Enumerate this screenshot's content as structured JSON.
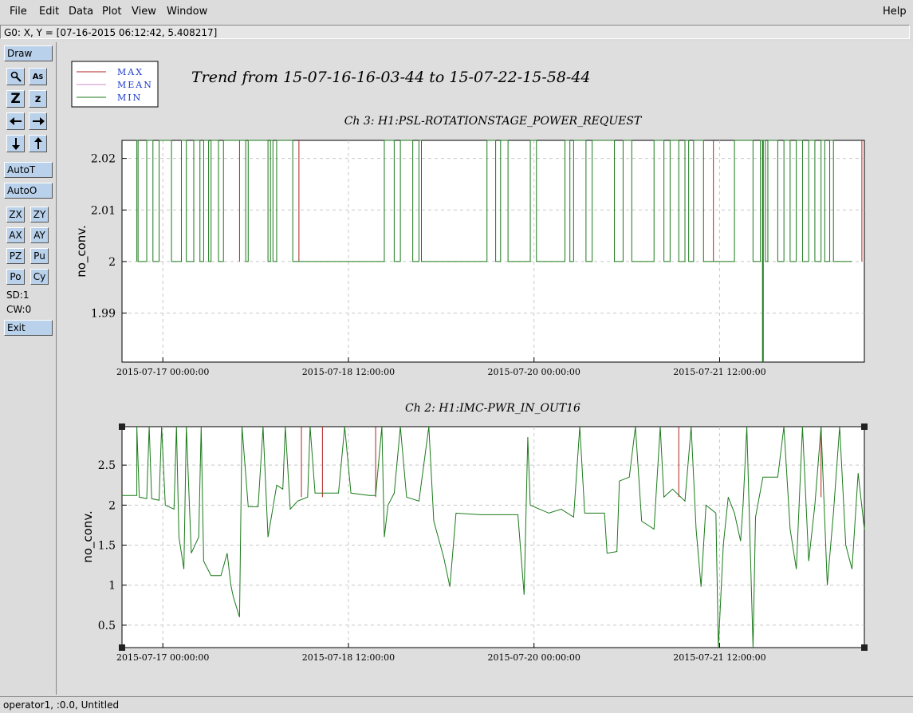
{
  "menu": {
    "file": "File",
    "edit": "Edit",
    "data": "Data",
    "plot": "Plot",
    "view": "View",
    "window": "Window",
    "help": "Help"
  },
  "coord_readout": "G0: X, Y = [07-16-2015 06:12:42, 5.408217]",
  "toolbox": {
    "draw": "Draw",
    "autot": "AutoT",
    "autoo": "AutoO",
    "zx": "ZX",
    "zy": "ZY",
    "ax": "AX",
    "ay": "AY",
    "pz": "PZ",
    "pu": "Pu",
    "po": "Po",
    "cy": "Cy",
    "sd": "SD:1",
    "cw": "CW:0",
    "exit": "Exit"
  },
  "legend": {
    "max": "MAX",
    "mean": "MEAN",
    "min": "MIN",
    "colors": {
      "max": "#b22222",
      "mean": "#cc88cc",
      "min": "#1a7a1a"
    }
  },
  "plot_title": "Trend from 15-07-16-16-03-44 to 15-07-22-15-58-44",
  "status": "operator1, :0.0, Untitled",
  "chart_data": [
    {
      "type": "line",
      "title": "Ch 3: H1:PSL-ROTATIONSTAGE_POWER_REQUEST",
      "ylabel": "no_conv.",
      "xlabel": "",
      "x_ticks": [
        "2015-07-17 00:00:00",
        "2015-07-18 12:00:00",
        "2015-07-20 00:00:00",
        "2015-07-21 12:00:00"
      ],
      "y_ticks": [
        "2.02",
        "2.01",
        "2",
        "1.99"
      ],
      "ylim": [
        1.9805,
        2.0235
      ],
      "x_days": [
        0,
        6
      ],
      "x_tick_days": [
        0.33,
        1.83,
        3.33,
        4.83
      ],
      "grid": true,
      "baseline": 2.0,
      "high": 2.0235,
      "series": [
        {
          "name": "MIN",
          "pulses_days": [
            [
              0.12,
              0.13
            ],
            [
              0.2,
              0.25
            ],
            [
              0.3,
              0.4
            ],
            [
              0.48,
              0.52
            ],
            [
              0.58,
              0.63
            ],
            [
              0.66,
              0.7
            ],
            [
              0.72,
              0.78
            ],
            [
              0.82,
              1.0
            ],
            [
              1.02,
              1.18
            ],
            [
              1.2,
              1.22
            ],
            [
              1.25,
              1.38
            ],
            [
              2.12,
              2.2
            ],
            [
              2.25,
              2.35
            ],
            [
              2.4,
              2.42
            ],
            [
              2.95,
              3.02
            ],
            [
              3.06,
              3.12
            ],
            [
              3.3,
              3.35
            ],
            [
              3.58,
              3.62
            ],
            [
              3.65,
              3.75
            ],
            [
              3.8,
              3.98
            ],
            [
              4.05,
              4.12
            ],
            [
              4.3,
              4.38
            ],
            [
              4.43,
              4.5
            ],
            [
              4.55,
              4.58
            ],
            [
              4.62,
              4.7
            ],
            [
              4.95,
              5.1
            ],
            [
              5.16,
              5.2
            ],
            [
              5.22,
              5.3
            ],
            [
              5.35,
              5.4
            ],
            [
              5.45,
              5.5
            ],
            [
              5.55,
              5.6
            ],
            [
              5.65,
              5.68
            ],
            [
              5.72,
              5.75
            ]
          ],
          "dip_day": 5.18,
          "dip": 1.9805
        },
        {
          "name": "MAX",
          "spikes_days": [
            0.95,
            1.43,
            4.78,
            5.98
          ]
        }
      ]
    },
    {
      "type": "line",
      "title": "Ch 2: H1:IMC-PWR_IN_OUT16",
      "ylabel": "no_conv.",
      "xlabel": "",
      "x_ticks": [
        "2015-07-17 00:00:00",
        "2015-07-18 12:00:00",
        "2015-07-20 00:00:00",
        "2015-07-21 12:00:00"
      ],
      "y_ticks": [
        "2.5",
        "2",
        "1.5",
        "1",
        "0.5"
      ],
      "ylim": [
        0.22,
        2.98
      ],
      "x_days": [
        0,
        6
      ],
      "x_tick_days": [
        0.33,
        1.83,
        3.33,
        4.83
      ],
      "grid": true,
      "series": [
        {
          "name": "MIN",
          "points_days": [
            [
              0,
              2.12
            ],
            [
              0.12,
              2.12
            ],
            [
              0.12,
              2.98
            ],
            [
              0.14,
              2.1
            ],
            [
              0.2,
              2.08
            ],
            [
              0.22,
              2.98
            ],
            [
              0.24,
              2.08
            ],
            [
              0.3,
              2.06
            ],
            [
              0.32,
              2.98
            ],
            [
              0.35,
              2.0
            ],
            [
              0.42,
              1.95
            ],
            [
              0.44,
              2.98
            ],
            [
              0.46,
              1.6
            ],
            [
              0.5,
              1.2
            ],
            [
              0.52,
              2.98
            ],
            [
              0.56,
              1.4
            ],
            [
              0.62,
              1.6
            ],
            [
              0.64,
              2.98
            ],
            [
              0.66,
              1.3
            ],
            [
              0.72,
              1.12
            ],
            [
              0.8,
              1.12
            ],
            [
              0.85,
              1.4
            ],
            [
              0.88,
              1.0
            ],
            [
              0.9,
              0.85
            ],
            [
              0.95,
              0.6
            ],
            [
              0.97,
              2.98
            ],
            [
              1.02,
              1.98
            ],
            [
              1.1,
              1.98
            ],
            [
              1.14,
              2.98
            ],
            [
              1.18,
              1.6
            ],
            [
              1.25,
              2.25
            ],
            [
              1.3,
              2.2
            ],
            [
              1.32,
              2.98
            ],
            [
              1.36,
              1.95
            ],
            [
              1.42,
              2.05
            ],
            [
              1.5,
              2.1
            ],
            [
              1.52,
              2.98
            ],
            [
              1.56,
              2.15
            ],
            [
              1.7,
              2.15
            ],
            [
              1.75,
              2.15
            ],
            [
              1.8,
              2.98
            ],
            [
              1.85,
              2.15
            ],
            [
              2.0,
              2.12
            ],
            [
              2.05,
              2.12
            ],
            [
              2.1,
              2.98
            ],
            [
              2.12,
              1.6
            ],
            [
              2.15,
              2.0
            ],
            [
              2.2,
              2.15
            ],
            [
              2.25,
              2.98
            ],
            [
              2.3,
              2.1
            ],
            [
              2.4,
              2.05
            ],
            [
              2.48,
              2.98
            ],
            [
              2.52,
              1.8
            ],
            [
              2.6,
              1.35
            ],
            [
              2.65,
              0.98
            ],
            [
              2.7,
              1.9
            ],
            [
              2.9,
              1.88
            ],
            [
              3.2,
              1.88
            ],
            [
              3.25,
              0.88
            ],
            [
              3.28,
              2.85
            ],
            [
              3.3,
              2.0
            ],
            [
              3.45,
              1.9
            ],
            [
              3.55,
              1.95
            ],
            [
              3.65,
              1.85
            ],
            [
              3.7,
              2.98
            ],
            [
              3.74,
              1.9
            ],
            [
              3.9,
              1.9
            ],
            [
              3.92,
              1.4
            ],
            [
              4.0,
              1.42
            ],
            [
              4.02,
              2.3
            ],
            [
              4.1,
              2.35
            ],
            [
              4.15,
              2.98
            ],
            [
              4.2,
              1.8
            ],
            [
              4.3,
              1.7
            ],
            [
              4.35,
              2.98
            ],
            [
              4.38,
              2.1
            ],
            [
              4.45,
              2.2
            ],
            [
              4.55,
              2.05
            ],
            [
              4.6,
              2.98
            ],
            [
              4.64,
              1.7
            ],
            [
              4.68,
              0.98
            ],
            [
              4.72,
              2.0
            ],
            [
              4.8,
              1.9
            ],
            [
              4.82,
              0.22
            ],
            [
              4.86,
              1.5
            ],
            [
              4.9,
              2.1
            ],
            [
              4.95,
              1.9
            ],
            [
              5.0,
              1.55
            ],
            [
              5.02,
              2.0
            ],
            [
              5.05,
              2.98
            ],
            [
              5.1,
              0.22
            ],
            [
              5.12,
              1.85
            ],
            [
              5.18,
              2.35
            ],
            [
              5.3,
              2.35
            ],
            [
              5.35,
              2.98
            ],
            [
              5.4,
              1.7
            ],
            [
              5.45,
              1.2
            ],
            [
              5.5,
              2.98
            ],
            [
              5.55,
              1.3
            ],
            [
              5.6,
              2.0
            ],
            [
              5.65,
              2.98
            ],
            [
              5.7,
              1.0
            ],
            [
              5.75,
              1.9
            ],
            [
              5.8,
              2.98
            ],
            [
              5.85,
              1.5
            ],
            [
              5.9,
              1.2
            ],
            [
              5.95,
              2.4
            ],
            [
              6.0,
              1.7
            ]
          ]
        },
        {
          "name": "MAX",
          "spikes_days": [
            [
              1.45,
              2.98
            ],
            [
              1.62,
              2.98
            ],
            [
              2.05,
              2.98
            ],
            [
              4.5,
              2.98
            ],
            [
              5.65,
              2.98
            ]
          ]
        }
      ]
    }
  ]
}
